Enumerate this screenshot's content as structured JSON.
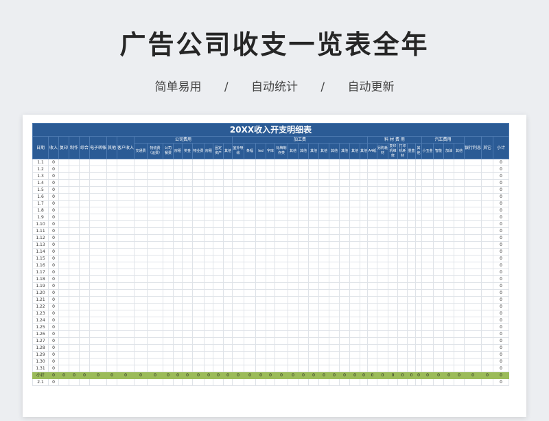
{
  "page": {
    "title": "广告公司收支一览表全年",
    "tags": [
      "简单易用",
      "自动统计",
      "自动更新"
    ],
    "separator": "/"
  },
  "sheet": {
    "banner": "20XX收入开支明细表",
    "groups": {
      "company": "公司费用",
      "process": "加工费",
      "material": "料 材 费 用",
      "car": "汽车费用"
    },
    "headers": [
      "日期",
      "收入",
      "复印",
      "制作",
      "综合",
      "电子转帐",
      "其他",
      "客户收入",
      "交通费",
      "物流费（运费）",
      "公司餐费",
      "房租",
      "奖金",
      "物业费",
      "房租",
      "固定资产",
      "其他",
      "室外喷绘",
      "条幅",
      "led",
      "字库",
      "标牌制作类",
      "其他",
      "其他",
      "其他",
      "其他",
      "其他",
      "其他",
      "其他",
      "其他",
      "A4纸",
      "另购耗材",
      "复印机维修",
      "打印机耗材",
      "墨盒",
      "其他",
      "小五金",
      "智能",
      "加油",
      "其他",
      "银行利息",
      "其它",
      "小计"
    ],
    "dates": [
      "1.1",
      "1.2",
      "1.3",
      "1.4",
      "1.5",
      "1.6",
      "1.7",
      "1.8",
      "1.9",
      "1.10",
      "1.11",
      "1.12",
      "1.13",
      "1.14",
      "1.15",
      "1.16",
      "1.17",
      "1.18",
      "1.19",
      "1.20",
      "1.21",
      "1.22",
      "1.23",
      "1.24",
      "1.25",
      "1.26",
      "1.27",
      "1.28",
      "1.29",
      "1.30",
      "1.31"
    ],
    "zero": "0",
    "subtotal_label": "小计",
    "next_date": "2.1"
  }
}
